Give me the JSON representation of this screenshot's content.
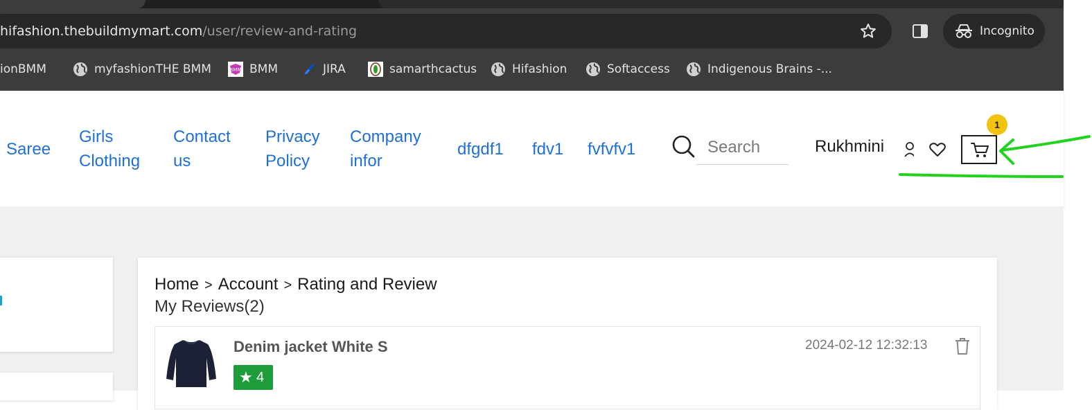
{
  "browser": {
    "url_host": "hifashion.thebuildmymart.com",
    "url_path": "/user/review-and-rating",
    "incognito_label": "Incognito",
    "bookmarks": [
      {
        "label": "ionBMM",
        "icon": "none"
      },
      {
        "label": "myfashionTHE BMM",
        "icon": "globe-icon"
      },
      {
        "label": "BMM",
        "icon": "bmm-logo-icon"
      },
      {
        "label": "JIRA",
        "icon": "jira-icon"
      },
      {
        "label": "samarthcactus",
        "icon": "cactus-logo-icon"
      },
      {
        "label": "Hifashion",
        "icon": "globe-icon"
      },
      {
        "label": "Softaccess",
        "icon": "globe-icon"
      },
      {
        "label": "Indigenous Brains -...",
        "icon": "globe-icon"
      }
    ]
  },
  "header": {
    "nav": [
      {
        "line1": "Saree",
        "line2": ""
      },
      {
        "line1": "Girls",
        "line2": "Clothing"
      },
      {
        "line1": "Contact",
        "line2": "us"
      },
      {
        "line1": "Privacy",
        "line2": "Policy"
      },
      {
        "line1": "Company",
        "line2": "infor"
      },
      {
        "line1": "dfgdf1",
        "line2": ""
      },
      {
        "line1": "fdv1",
        "line2": ""
      },
      {
        "line1": "fvfvfv1",
        "line2": ""
      }
    ],
    "search_placeholder": "Search",
    "username": "Rukhmini",
    "cart_count": "1",
    "link_color": "#1e6fd9"
  },
  "main": {
    "breadcrumb": [
      "Home",
      "Account",
      "Rating and Review"
    ],
    "reviews_title": "My Reviews(2)",
    "reviews": [
      {
        "product_name": "Denim jacket White S",
        "rating": "4",
        "date": "2024-02-12 12:32:13"
      }
    ]
  },
  "colors": {
    "rating_badge": "#1f9d3a",
    "annotation": "#22d21f",
    "cart_badge": "#f2c40f"
  }
}
